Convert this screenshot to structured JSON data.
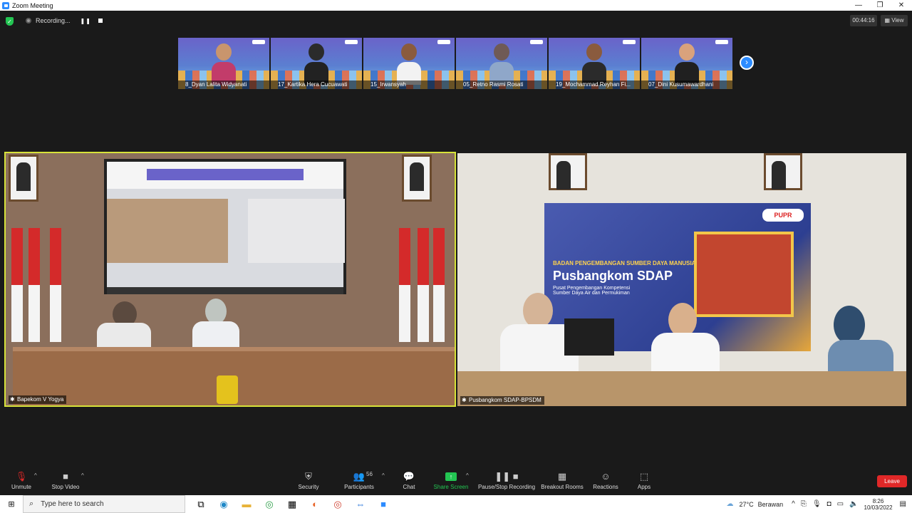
{
  "window": {
    "title": "Zoom Meeting",
    "controls": [
      "—",
      "❐",
      "✕"
    ]
  },
  "recording": {
    "label": "Recording...",
    "pause": "❚❚"
  },
  "timer": "00:44:16",
  "view_button": "View",
  "thumbnails": [
    {
      "name": "8_Dyan Lalita Widyanati",
      "skin": "#c9956d",
      "cloth": "#c23c6a"
    },
    {
      "name": "17_Kartika Hera Cucuawati",
      "skin": "#2b2b2b",
      "cloth": "#222222"
    },
    {
      "name": "15_Irwansyah",
      "skin": "#8a5b3e",
      "cloth": "#f2f2f2"
    },
    {
      "name": "05_Retno Rasmi Rosati",
      "skin": "#6f5a56",
      "cloth": "#8fa7c9"
    },
    {
      "name": "19_Mochammad Reyhan Fi...",
      "skin": "#8a5b3e",
      "cloth": "#2b2b2b"
    },
    {
      "name": "07_Dini Kusumawardhani",
      "skin": "#d9a27c",
      "cloth": "#202020"
    }
  ],
  "next_arrow": "›",
  "videos": {
    "left": {
      "name": "Bapekom V Yogya"
    },
    "right": {
      "name": "Pusbangkom SDAP-BPSDM",
      "banner_top": "BADAN PENGEMBANGAN SUMBER DAYA MANUSIA",
      "banner_title": "Pusbangkom SDAP",
      "banner_sub": "Pusat Pengembangan Kompetensi Sumber Daya Air dan Permukiman",
      "banner_logo": "PUPR"
    }
  },
  "toolbar": {
    "unmute": "Unmute",
    "stop_video": "Stop Video",
    "security": "Security",
    "participants": "Participants",
    "participant_count": "56",
    "chat": "Chat",
    "share_screen": "Share Screen",
    "pause_stop_recording": "Pause/Stop Recording",
    "breakout_rooms": "Breakout Rooms",
    "reactions": "Reactions",
    "apps": "Apps",
    "leave": "Leave"
  },
  "taskbar": {
    "search_placeholder": "Type here to search",
    "weather_temp": "27°C",
    "weather_desc": "Berawan",
    "time": "8:26",
    "date": "10/03/2022"
  },
  "icons": {
    "mic_muted": "mic-muted-icon",
    "camera": "camera-icon",
    "shield": "shield-icon",
    "people": "people-icon",
    "chat": "chat-icon",
    "share": "share-up-arrow-icon",
    "record": "record-pause-icon",
    "grid": "grid-icon",
    "smile": "smile-plus-icon",
    "apps": "apps-icon"
  },
  "colors": {
    "accent": "#2d8cff",
    "active_border": "#d7e33a",
    "leave": "#e02828",
    "green": "#23c552"
  }
}
